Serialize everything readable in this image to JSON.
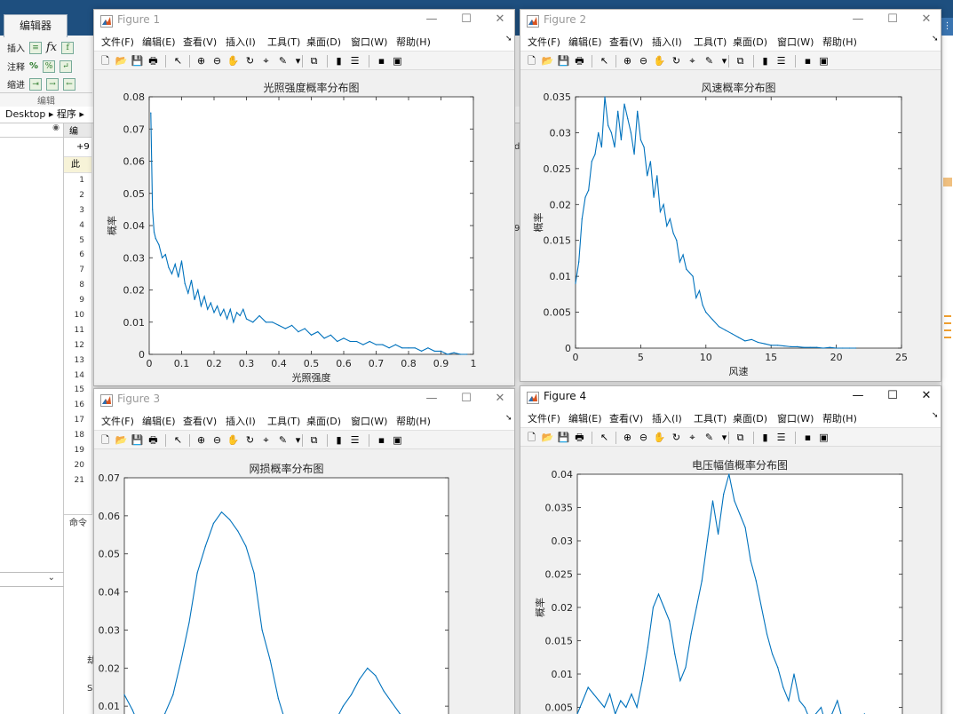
{
  "background": {
    "toolstrip_tab": "编辑器",
    "ribbon": {
      "insert_label": "插入",
      "comment_label": "注释",
      "indent_label": "缩进",
      "group_label": "编辑",
      "fx_label": "fx"
    },
    "address_bar": "Desktop ▸ 程序 ▸",
    "editor_tab": "编",
    "editor_toolbar": "+9",
    "editor_info": "此",
    "line_numbers": [
      "1",
      "2",
      "3",
      "4",
      "5",
      "6",
      "7",
      "8",
      "9",
      "10",
      "11",
      "12",
      "13",
      "14",
      "15",
      "16",
      "17",
      "18",
      "19",
      "20",
      "21"
    ],
    "command_window_label": "命令",
    "cmd_texts": [
      "劫",
      "S"
    ],
    "side_fragment_d": "d",
    "side_fragment_9": "9"
  },
  "windows": [
    {
      "id": "figure1",
      "title": "Figure 1",
      "active": false,
      "menu": [
        "文件(F)",
        "编辑(E)",
        "查看(V)",
        "插入(I)",
        "工具(T)",
        "桌面(D)",
        "窗口(W)",
        "帮助(H)"
      ]
    },
    {
      "id": "figure2",
      "title": "Figure 2",
      "active": false,
      "menu": [
        "文件(F)",
        "编辑(E)",
        "查看(V)",
        "插入(I)",
        "工具(T)",
        "桌面(D)",
        "窗口(W)",
        "帮助(H)"
      ]
    },
    {
      "id": "figure3",
      "title": "Figure 3",
      "active": false,
      "menu": [
        "文件(F)",
        "编辑(E)",
        "查看(V)",
        "插入(I)",
        "工具(T)",
        "桌面(D)",
        "窗口(W)",
        "帮助(H)"
      ]
    },
    {
      "id": "figure4",
      "title": "Figure 4",
      "active": true,
      "menu": [
        "文件(F)",
        "编辑(E)",
        "查看(V)",
        "插入(I)",
        "工具(T)",
        "桌面(D)",
        "窗口(W)",
        "帮助(H)"
      ]
    }
  ],
  "window_controls": {
    "minimize": "—",
    "maximize": "☐",
    "close": "✕"
  },
  "colors": {
    "line": "#0072BD",
    "axes_bg": "#ffffff",
    "figure_bg": "#f0f0f0"
  },
  "chart_data": [
    {
      "type": "line",
      "title": "光照强度概率分布图",
      "xlabel": "光照强度",
      "ylabel": "概率",
      "xlim": [
        0,
        1
      ],
      "ylim": [
        0,
        0.08
      ],
      "xticks": [
        0,
        0.1,
        0.2,
        0.3,
        0.4,
        0.5,
        0.6,
        0.7,
        0.8,
        0.9,
        1
      ],
      "yticks": [
        0,
        0.01,
        0.02,
        0.03,
        0.04,
        0.05,
        0.06,
        0.07,
        0.08
      ],
      "x": [
        0.005,
        0.01,
        0.015,
        0.02,
        0.03,
        0.04,
        0.05,
        0.06,
        0.07,
        0.08,
        0.09,
        0.1,
        0.11,
        0.12,
        0.13,
        0.14,
        0.15,
        0.16,
        0.17,
        0.18,
        0.19,
        0.2,
        0.21,
        0.22,
        0.23,
        0.24,
        0.25,
        0.26,
        0.27,
        0.28,
        0.29,
        0.3,
        0.32,
        0.34,
        0.36,
        0.38,
        0.4,
        0.42,
        0.44,
        0.46,
        0.48,
        0.5,
        0.52,
        0.54,
        0.56,
        0.58,
        0.6,
        0.62,
        0.64,
        0.66,
        0.68,
        0.7,
        0.72,
        0.74,
        0.76,
        0.78,
        0.8,
        0.82,
        0.84,
        0.86,
        0.88,
        0.9,
        0.92,
        0.94,
        0.96,
        0.98
      ],
      "y": [
        0.075,
        0.045,
        0.038,
        0.036,
        0.034,
        0.03,
        0.031,
        0.027,
        0.025,
        0.028,
        0.024,
        0.029,
        0.022,
        0.019,
        0.023,
        0.017,
        0.02,
        0.015,
        0.018,
        0.014,
        0.016,
        0.013,
        0.015,
        0.012,
        0.014,
        0.011,
        0.014,
        0.01,
        0.013,
        0.012,
        0.014,
        0.011,
        0.01,
        0.012,
        0.01,
        0.01,
        0.009,
        0.008,
        0.009,
        0.007,
        0.008,
        0.006,
        0.007,
        0.005,
        0.006,
        0.004,
        0.005,
        0.004,
        0.004,
        0.003,
        0.004,
        0.003,
        0.003,
        0.002,
        0.003,
        0.002,
        0.002,
        0.002,
        0.001,
        0.002,
        0.001,
        0.001,
        0.0,
        0.0005,
        0.0,
        0.0
      ]
    },
    {
      "type": "line",
      "title": "风速概率分布图",
      "xlabel": "风速",
      "ylabel": "概率",
      "xlim": [
        0,
        25
      ],
      "ylim": [
        0,
        0.035
      ],
      "xticks": [
        0,
        5,
        10,
        15,
        20,
        25
      ],
      "yticks": [
        0,
        0.005,
        0.01,
        0.015,
        0.02,
        0.025,
        0.03,
        0.035
      ],
      "x": [
        0,
        0.25,
        0.5,
        0.75,
        1,
        1.25,
        1.5,
        1.75,
        2,
        2.25,
        2.5,
        2.75,
        3,
        3.25,
        3.5,
        3.75,
        4,
        4.25,
        4.5,
        4.75,
        5,
        5.25,
        5.5,
        5.75,
        6,
        6.25,
        6.5,
        6.75,
        7,
        7.25,
        7.5,
        7.75,
        8,
        8.25,
        8.5,
        8.75,
        9,
        9.25,
        9.5,
        9.75,
        10,
        10.5,
        11,
        11.5,
        12,
        12.5,
        13,
        13.5,
        14,
        14.5,
        15,
        15.5,
        16,
        16.5,
        17,
        17.5,
        18,
        18.5,
        19,
        19.5,
        20,
        20.5,
        21,
        21.5
      ],
      "y": [
        0.009,
        0.012,
        0.018,
        0.021,
        0.022,
        0.026,
        0.027,
        0.03,
        0.028,
        0.035,
        0.031,
        0.03,
        0.028,
        0.033,
        0.029,
        0.034,
        0.032,
        0.03,
        0.027,
        0.033,
        0.029,
        0.028,
        0.024,
        0.026,
        0.021,
        0.024,
        0.019,
        0.02,
        0.017,
        0.018,
        0.016,
        0.015,
        0.012,
        0.013,
        0.011,
        0.0105,
        0.01,
        0.007,
        0.008,
        0.006,
        0.005,
        0.004,
        0.003,
        0.0025,
        0.002,
        0.0015,
        0.001,
        0.0012,
        0.0008,
        0.0006,
        0.0004,
        0.0004,
        0.0003,
        0.0002,
        0.0002,
        0.0001,
        0.0001,
        0.0001,
        0.0,
        0.0001,
        0.0,
        0.0,
        0.0,
        0.0
      ]
    },
    {
      "type": "line",
      "title": "网损概率分布图",
      "xlabel": "",
      "ylabel": "概率",
      "ylim": [
        0,
        0.07
      ],
      "yticks": [
        0.01,
        0.02,
        0.03,
        0.04,
        0.05,
        0.06,
        0.07
      ],
      "x": [
        0,
        1,
        2,
        3,
        4,
        5,
        6,
        7,
        8,
        9,
        10,
        11,
        12,
        13,
        14,
        15,
        16,
        17,
        18,
        19,
        20,
        21,
        22,
        23,
        24,
        25,
        26,
        27,
        28,
        29,
        30,
        31,
        32,
        33,
        34,
        35,
        36,
        37,
        38,
        39,
        40
      ],
      "y": [
        0.013,
        0.009,
        0.004,
        0.0,
        0.003,
        0.008,
        0.013,
        0.022,
        0.032,
        0.045,
        0.052,
        0.058,
        0.061,
        0.059,
        0.056,
        0.052,
        0.045,
        0.03,
        0.022,
        0.012,
        0.005,
        0.001,
        0.001,
        0.0,
        0.002,
        0.004,
        0.006,
        0.01,
        0.013,
        0.017,
        0.02,
        0.018,
        0.014,
        0.011,
        0.008,
        0.006,
        0.004,
        0.003,
        0.002,
        0.001,
        0.001
      ]
    },
    {
      "type": "line",
      "title": "电压幅值概率分布图",
      "xlabel": "",
      "ylabel": "概率",
      "ylim": [
        0,
        0.04
      ],
      "yticks": [
        0.005,
        0.01,
        0.015,
        0.02,
        0.025,
        0.03,
        0.035,
        0.04
      ],
      "x": [
        0,
        1,
        2,
        3,
        4,
        5,
        6,
        7,
        8,
        9,
        10,
        11,
        12,
        13,
        14,
        15,
        16,
        17,
        18,
        19,
        20,
        21,
        22,
        23,
        24,
        25,
        26,
        27,
        28,
        29,
        30,
        31,
        32,
        33,
        34,
        35,
        36,
        37,
        38,
        39,
        40,
        41,
        42,
        43,
        44,
        45,
        46,
        47,
        48,
        49,
        50,
        51,
        52,
        53,
        54,
        55,
        56,
        57,
        58,
        59,
        60
      ],
      "y": [
        0.004,
        0.006,
        0.008,
        0.007,
        0.006,
        0.005,
        0.007,
        0.004,
        0.006,
        0.005,
        0.007,
        0.005,
        0.009,
        0.014,
        0.02,
        0.022,
        0.02,
        0.018,
        0.013,
        0.009,
        0.011,
        0.016,
        0.02,
        0.024,
        0.03,
        0.036,
        0.031,
        0.037,
        0.04,
        0.036,
        0.034,
        0.032,
        0.027,
        0.024,
        0.02,
        0.016,
        0.013,
        0.011,
        0.008,
        0.006,
        0.01,
        0.006,
        0.005,
        0.003,
        0.004,
        0.005,
        0.002,
        0.004,
        0.006,
        0.003,
        0.001,
        0.002,
        0.003,
        0.004,
        0.002,
        0.001,
        0.003,
        0.002,
        0.002,
        0.001,
        0.001
      ]
    }
  ]
}
